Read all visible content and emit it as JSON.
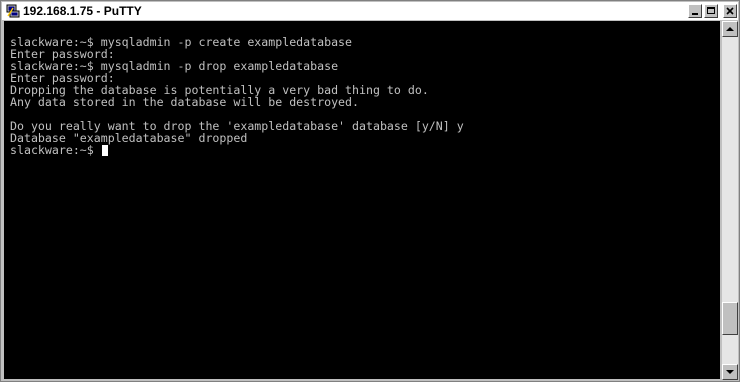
{
  "window": {
    "title": "192.168.1.75 - PuTTY",
    "app_icon": "putty-icon",
    "controls": {
      "minimize_icon": "minimize-icon",
      "maximize_icon": "maximize-icon",
      "close_icon": "close-icon"
    }
  },
  "terminal": {
    "background_color": "#000000",
    "text_color": "#c0c0c0",
    "lines": [
      "slackware:~$ mysqladmin -p create exampledatabase",
      "Enter password:",
      "slackware:~$ mysqladmin -p drop exampledatabase",
      "Enter password:",
      "Dropping the database is potentially a very bad thing to do.",
      "Any data stored in the database will be destroyed.",
      "",
      "Do you really want to drop the 'exampledatabase' database [y/N] y",
      "Database \"exampledatabase\" dropped",
      "slackware:~$ "
    ]
  },
  "scrollbar": {
    "up_icon": "scroll-up-arrow-icon",
    "down_icon": "scroll-down-arrow-icon",
    "thumb_position": 0.9
  }
}
